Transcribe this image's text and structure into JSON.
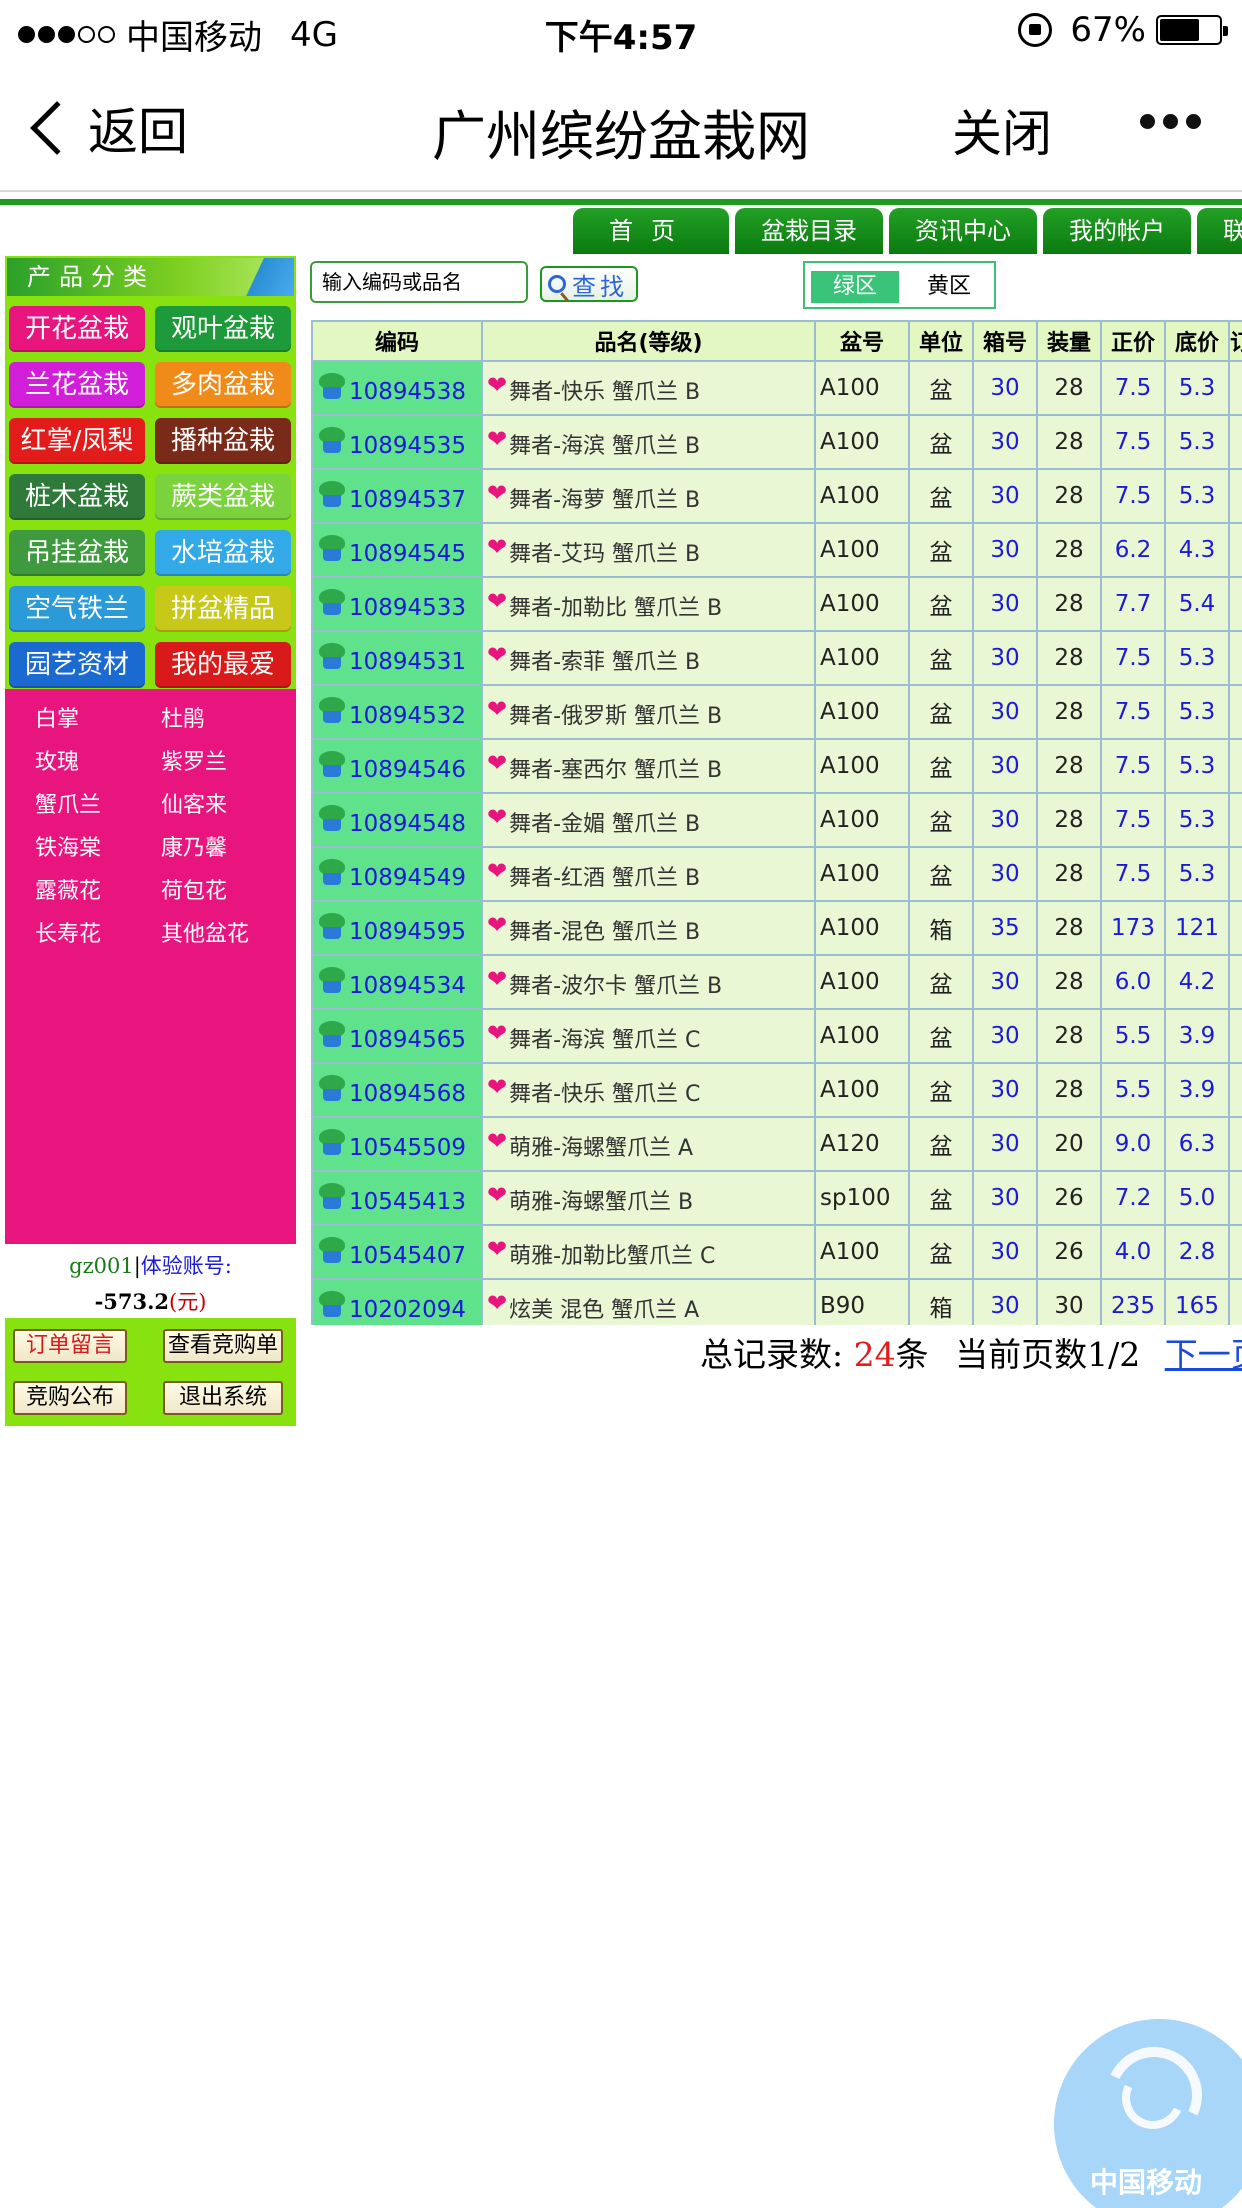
{
  "status_bar": {
    "carrier": "中国移动",
    "network": "4G",
    "time": "下午4:57",
    "battery": "67%",
    "battery_level": 0.67
  },
  "nav": {
    "back_label": "返回",
    "title": "广州缤纷盆栽网",
    "close_label": "关闭"
  },
  "top_menu": [
    "首页",
    "盆栽目录",
    "资讯中心",
    "我的帐户",
    "联系"
  ],
  "sidebar": {
    "header": "产品分类",
    "categories": [
      {
        "label": "开花盆栽",
        "color": "#e8157f"
      },
      {
        "label": "观叶盆栽",
        "color": "#1e9a3a"
      },
      {
        "label": "兰花盆栽",
        "color": "#d11ed8"
      },
      {
        "label": "多肉盆栽",
        "color": "#f08b1a"
      },
      {
        "label": "红掌/凤梨",
        "color": "#e21b1b"
      },
      {
        "label": "播种盆栽",
        "color": "#7a2a18"
      },
      {
        "label": "桩木盆栽",
        "color": "#2f7a3a"
      },
      {
        "label": "蕨类盆栽",
        "color": "#7ad23c"
      },
      {
        "label": "吊挂盆栽",
        "color": "#3f9a3f"
      },
      {
        "label": "水培盆栽",
        "color": "#33a9e8"
      },
      {
        "label": "空气铁兰",
        "color": "#2a9ad8"
      },
      {
        "label": "拼盆精品",
        "color": "#c7c81a"
      },
      {
        "label": "园艺资材",
        "color": "#1a6ad2"
      },
      {
        "label": "我的最爱",
        "color": "#d81a1a"
      }
    ],
    "subcategories": [
      "白掌",
      "杜鹃",
      "玫瑰",
      "紫罗兰",
      "蟹爪兰",
      "仙客来",
      "铁海棠",
      "康乃馨",
      "露薇花",
      "荷包花",
      "长寿花",
      "其他盆花"
    ],
    "account": {
      "user": "gz001",
      "separator": "|",
      "label": "体验账号:",
      "balance": "-573.2",
      "unit": "(元)"
    },
    "actions": [
      "订单留言",
      "查看竞购单",
      "竞购公布",
      "退出系统"
    ]
  },
  "search": {
    "placeholder": "输入编码或品名",
    "button_label": "查找"
  },
  "zones": {
    "active": "绿区",
    "other": "黄区"
  },
  "table": {
    "headers": [
      "编码",
      "品名(等级)",
      "盆号",
      "单位",
      "箱号",
      "装量",
      "正价",
      "底价",
      "订"
    ],
    "rows": [
      {
        "code": "10894538",
        "name": "舞者-快乐 蟹爪兰 B",
        "pot": "A100",
        "unit": "盆",
        "box": "30",
        "qty": "28",
        "price": "7.5",
        "base": "5.3"
      },
      {
        "code": "10894535",
        "name": "舞者-海滨 蟹爪兰 B",
        "pot": "A100",
        "unit": "盆",
        "box": "30",
        "qty": "28",
        "price": "7.5",
        "base": "5.3"
      },
      {
        "code": "10894537",
        "name": "舞者-海萝 蟹爪兰 B",
        "pot": "A100",
        "unit": "盆",
        "box": "30",
        "qty": "28",
        "price": "7.5",
        "base": "5.3"
      },
      {
        "code": "10894545",
        "name": "舞者-艾玛 蟹爪兰 B",
        "pot": "A100",
        "unit": "盆",
        "box": "30",
        "qty": "28",
        "price": "6.2",
        "base": "4.3"
      },
      {
        "code": "10894533",
        "name": "舞者-加勒比 蟹爪兰 B",
        "pot": "A100",
        "unit": "盆",
        "box": "30",
        "qty": "28",
        "price": "7.7",
        "base": "5.4"
      },
      {
        "code": "10894531",
        "name": "舞者-索菲 蟹爪兰 B",
        "pot": "A100",
        "unit": "盆",
        "box": "30",
        "qty": "28",
        "price": "7.5",
        "base": "5.3"
      },
      {
        "code": "10894532",
        "name": "舞者-俄罗斯 蟹爪兰 B",
        "pot": "A100",
        "unit": "盆",
        "box": "30",
        "qty": "28",
        "price": "7.5",
        "base": "5.3"
      },
      {
        "code": "10894546",
        "name": "舞者-塞西尔 蟹爪兰 B",
        "pot": "A100",
        "unit": "盆",
        "box": "30",
        "qty": "28",
        "price": "7.5",
        "base": "5.3"
      },
      {
        "code": "10894548",
        "name": "舞者-金媚 蟹爪兰 B",
        "pot": "A100",
        "unit": "盆",
        "box": "30",
        "qty": "28",
        "price": "7.5",
        "base": "5.3"
      },
      {
        "code": "10894549",
        "name": "舞者-红酒 蟹爪兰 B",
        "pot": "A100",
        "unit": "盆",
        "box": "30",
        "qty": "28",
        "price": "7.5",
        "base": "5.3"
      },
      {
        "code": "10894595",
        "name": "舞者-混色 蟹爪兰 B",
        "pot": "A100",
        "unit": "箱",
        "box": "35",
        "qty": "28",
        "price": "173",
        "base": "121"
      },
      {
        "code": "10894534",
        "name": "舞者-波尔卡 蟹爪兰 B",
        "pot": "A100",
        "unit": "盆",
        "box": "30",
        "qty": "28",
        "price": "6.0",
        "base": "4.2"
      },
      {
        "code": "10894565",
        "name": "舞者-海滨 蟹爪兰 C",
        "pot": "A100",
        "unit": "盆",
        "box": "30",
        "qty": "28",
        "price": "5.5",
        "base": "3.9"
      },
      {
        "code": "10894568",
        "name": "舞者-快乐 蟹爪兰 C",
        "pot": "A100",
        "unit": "盆",
        "box": "30",
        "qty": "28",
        "price": "5.5",
        "base": "3.9"
      },
      {
        "code": "10545509",
        "name": "萌雅-海螺蟹爪兰 A",
        "pot": "A120",
        "unit": "盆",
        "box": "30",
        "qty": "20",
        "price": "9.0",
        "base": "6.3"
      },
      {
        "code": "10545413",
        "name": "萌雅-海螺蟹爪兰 B",
        "pot": "sp100",
        "unit": "盆",
        "box": "30",
        "qty": "26",
        "price": "7.2",
        "base": "5.0"
      },
      {
        "code": "10545407",
        "name": "萌雅-加勒比蟹爪兰 C",
        "pot": "A100",
        "unit": "盆",
        "box": "30",
        "qty": "26",
        "price": "4.0",
        "base": "2.8"
      },
      {
        "code": "10202094",
        "name": "炫美 混色 蟹爪兰 A",
        "pot": "B90",
        "unit": "箱",
        "box": "30",
        "qty": "30",
        "price": "235",
        "base": "165"
      }
    ]
  },
  "footer": {
    "total_label": "总记录数:",
    "total_count": "24",
    "total_unit": "条",
    "page_label": "当前页数1/2",
    "next_label": "下一页"
  },
  "watermark": {
    "text": "中国移动"
  }
}
